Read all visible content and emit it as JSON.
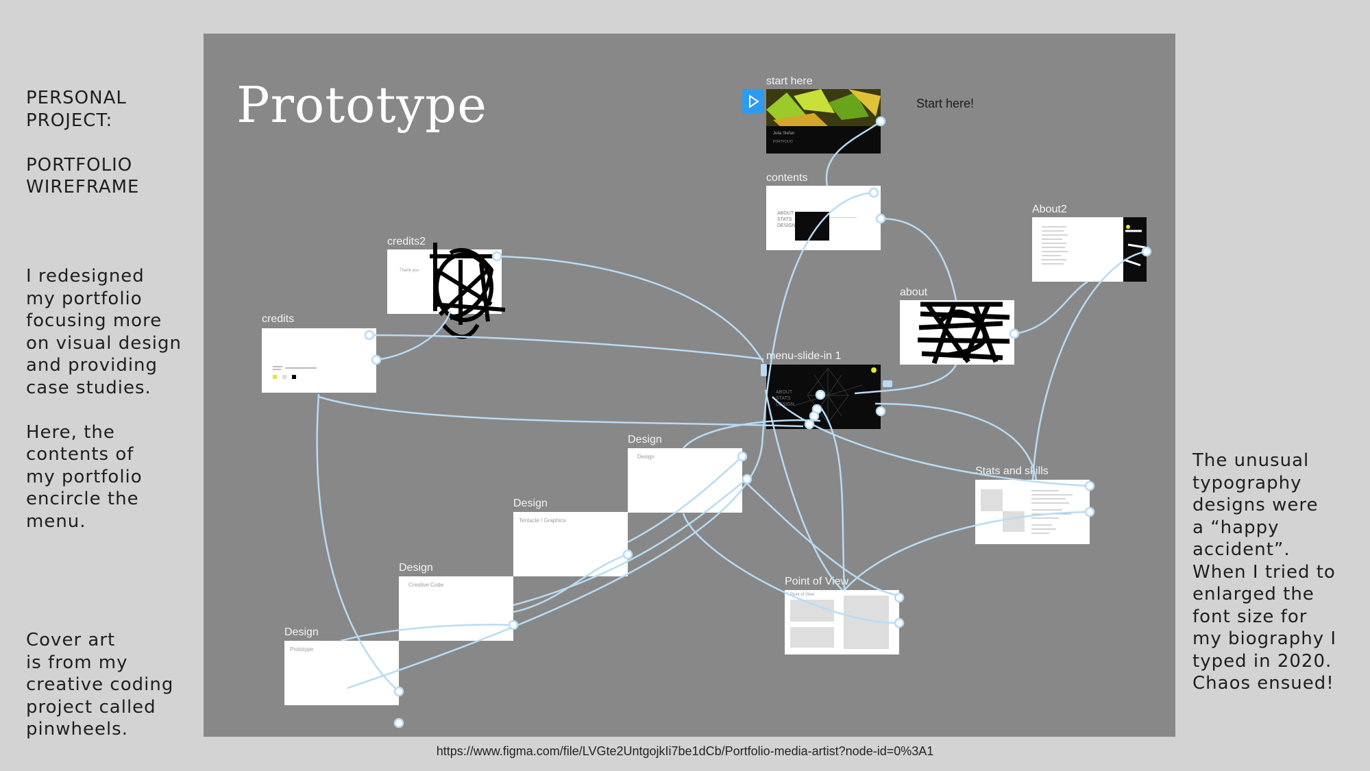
{
  "left_panel": {
    "heading": "PERSONAL\nPROJECT:\n\nPORTFOLIO\nWIREFRAME",
    "description": "I redesigned\nmy portfolio\nfocusing more\non visual design\nand providing\ncase studies.\n\nHere, the\ncontents  of\nmy portfolio\nencircle the\nmenu.",
    "cover_note": "Cover art\nis from my\ncreative coding\nproject called\npinwheels."
  },
  "right_panel": {
    "note": "The unusual\ntypography\ndesigns were\na “happy\naccident”.\nWhen I tried to\nenlarged the\nfont size for\nmy biography I\ntyped in 2020.\nChaos ensued!"
  },
  "canvas": {
    "title": "Prototype",
    "start_note": "Start here!",
    "frames": {
      "start_here": "start here",
      "contents": "contents",
      "about2": "About2",
      "about": "about",
      "credits2": "credits2",
      "credits": "credits",
      "menu_slide_in": "menu-slide-in 1",
      "design_1": "Design",
      "design_2": "Design",
      "design_3": "Design",
      "design_4": "Design",
      "stats_and_skills": "Stats and skills",
      "point_of_view": "Point of View"
    },
    "frame_text": {
      "start_name": "Julia Stefan",
      "start_sub": "PORTFOLIO",
      "design_1": "Design",
      "design_2": "Tentacle / Graphics",
      "design_3": "Creative Code",
      "design_4": "Prototype",
      "point_of_view": "Point of View",
      "credits2": "Thank you",
      "menu_items": "ABOUT\nSTATS\nDESIGN"
    }
  },
  "footer": {
    "url": "https://www.figma.com/file/LVGte2UntgojkIi7be1dCb/Portfolio-media-artist?node-id=0%3A1"
  },
  "colors": {
    "canvas": "#888888",
    "connector": "#b9dbf4",
    "play_button": "#2d9bf0"
  }
}
